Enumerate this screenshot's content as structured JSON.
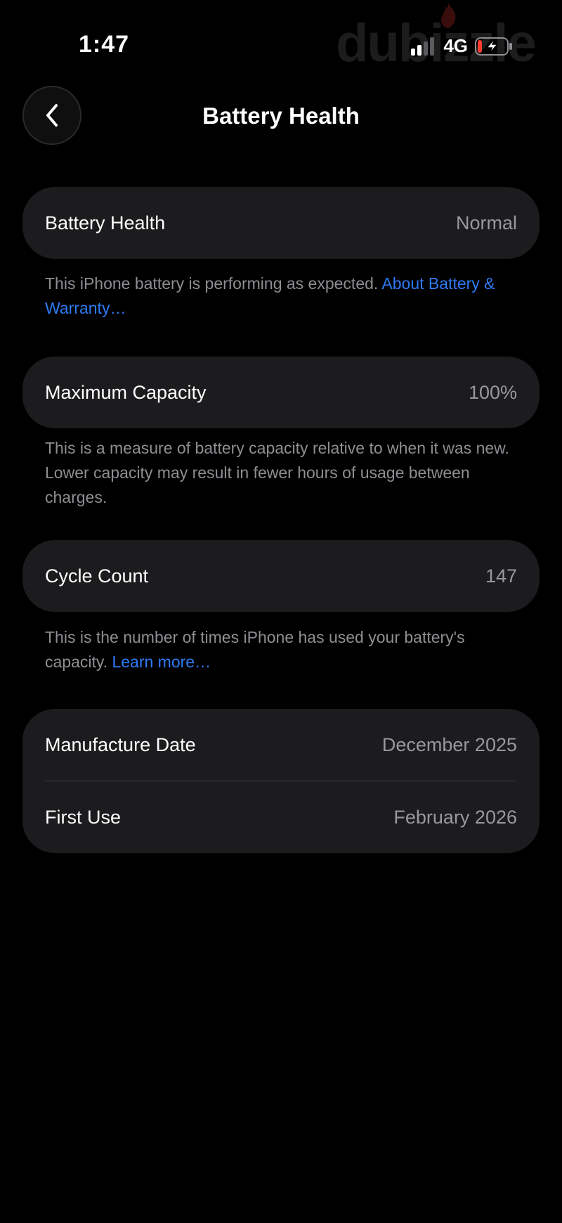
{
  "status_bar": {
    "time": "1:47",
    "network": "4G",
    "signal_icon": "cellular-signal-icon",
    "battery_icon": "battery-charging-icon",
    "watermark": "dubizzle"
  },
  "nav": {
    "back_icon": "chevron-left-icon",
    "title": "Battery Health"
  },
  "sections": {
    "health": {
      "label": "Battery Health",
      "value": "Normal",
      "note_text": "This iPhone battery is performing as expected. ",
      "note_link": "About Battery & Warranty…"
    },
    "capacity": {
      "label": "Maximum Capacity",
      "value": "100%",
      "note_text": "This is a measure of battery capacity relative to when it was new. Lower capacity may result in fewer hours of usage between charges."
    },
    "cycles": {
      "label": "Cycle Count",
      "value": "147",
      "note_text": "This is the number of times iPhone has used your battery's capacity. ",
      "note_link": "Learn more…"
    },
    "dates": {
      "manufacture_label": "Manufacture Date",
      "manufacture_value": "December 2025",
      "first_use_label": "First Use",
      "first_use_value": "February 2026"
    }
  },
  "colors": {
    "background": "#000000",
    "card": "#1c1c1e",
    "secondary_text": "#98989d",
    "link": "#2f7bf5",
    "battery_low": "#ff3b30"
  }
}
